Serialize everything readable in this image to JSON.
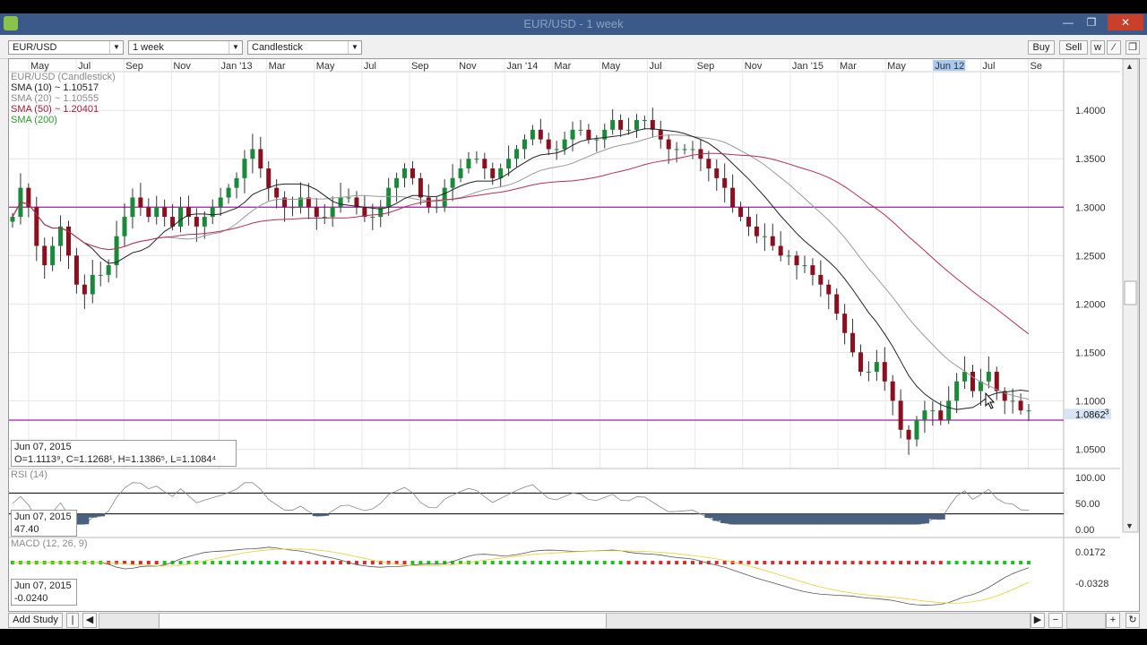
{
  "window": {
    "title": "EUR/USD - 1 week"
  },
  "toolbar": {
    "symbol": "EUR/USD",
    "interval": "1 week",
    "chart_type": "Candlestick",
    "buy_label": "Buy",
    "sell_label": "Sell"
  },
  "time_axis": [
    "May",
    "Jul",
    "Sep",
    "Nov",
    "Jan '13",
    "Mar",
    "May",
    "Jul",
    "Sep",
    "Nov",
    "Jan '14",
    "Mar",
    "May",
    "Jul",
    "Sep",
    "Nov",
    "Jan '15",
    "Mar",
    "May",
    "Jun 12",
    "Jul",
    "Se"
  ],
  "price_axis": [
    "1.4000",
    "1.3500",
    "1.3000",
    "1.2500",
    "1.2000",
    "1.1500",
    "1.1000",
    "1.0500"
  ],
  "current_price_label": "1.0862",
  "current_price_sup": "3",
  "legend": [
    {
      "text": "EUR/USD (Candlestick)",
      "color": "#8a8a8a"
    },
    {
      "text": "SMA (10) ~ 1.10517",
      "color": "#222222"
    },
    {
      "text": "SMA (20) ~ 1.10555",
      "color": "#8a8a8a"
    },
    {
      "text": "SMA (50) ~ 1.20401",
      "color": "#a0203a"
    },
    {
      "text": "SMA (200)",
      "color": "#2a9a2a"
    }
  ],
  "crosshair_info": {
    "date": "Jun 07, 2015",
    "ohlc": "O=1.1113⁹, C=1.1268¹, H=1.1386⁵, L=1.1084⁴"
  },
  "rsi": {
    "title": "RSI (14)",
    "axis": [
      "100.00",
      "50.00",
      "0.00"
    ],
    "date": "Jun 07, 2015",
    "value": "47.40"
  },
  "macd": {
    "title": "MACD (12, 26, 9)",
    "axis": [
      "0.0172",
      "-0.0328"
    ],
    "date": "Jun 07, 2015",
    "value": "-0.0240"
  },
  "statusbar": {
    "add_study_label": "Add Study"
  },
  "colors": {
    "bull": "#1a8a3a",
    "bear": "#8a1020",
    "hline": "#a020a0",
    "sma50": "#b03050",
    "accent": "#3b5a8a"
  },
  "chart_data": {
    "type": "candlestick",
    "symbol": "EUR/USD",
    "interval": "1 week",
    "horizontal_lines": [
      1.3,
      1.08
    ],
    "ylim": [
      1.03,
      1.44
    ],
    "closes": [
      1.29,
      1.32,
      1.3,
      1.26,
      1.24,
      1.26,
      1.28,
      1.25,
      1.22,
      1.21,
      1.23,
      1.23,
      1.24,
      1.27,
      1.29,
      1.31,
      1.3,
      1.29,
      1.3,
      1.29,
      1.28,
      1.3,
      1.29,
      1.28,
      1.29,
      1.3,
      1.31,
      1.32,
      1.33,
      1.35,
      1.36,
      1.34,
      1.32,
      1.31,
      1.3,
      1.3,
      1.31,
      1.3,
      1.29,
      1.29,
      1.3,
      1.31,
      1.31,
      1.3,
      1.29,
      1.29,
      1.3,
      1.32,
      1.33,
      1.34,
      1.33,
      1.31,
      1.3,
      1.3,
      1.32,
      1.33,
      1.34,
      1.35,
      1.35,
      1.34,
      1.33,
      1.34,
      1.35,
      1.36,
      1.37,
      1.38,
      1.37,
      1.36,
      1.36,
      1.37,
      1.38,
      1.38,
      1.37,
      1.37,
      1.38,
      1.39,
      1.38,
      1.38,
      1.39,
      1.39,
      1.38,
      1.37,
      1.36,
      1.36,
      1.36,
      1.36,
      1.35,
      1.34,
      1.33,
      1.32,
      1.3,
      1.29,
      1.28,
      1.27,
      1.27,
      1.26,
      1.25,
      1.25,
      1.24,
      1.24,
      1.23,
      1.22,
      1.21,
      1.19,
      1.17,
      1.15,
      1.13,
      1.13,
      1.14,
      1.12,
      1.1,
      1.07,
      1.06,
      1.08,
      1.09,
      1.09,
      1.08,
      1.1,
      1.12,
      1.13,
      1.11,
      1.12,
      1.13,
      1.11,
      1.1,
      1.1,
      1.09,
      1.09
    ]
  }
}
